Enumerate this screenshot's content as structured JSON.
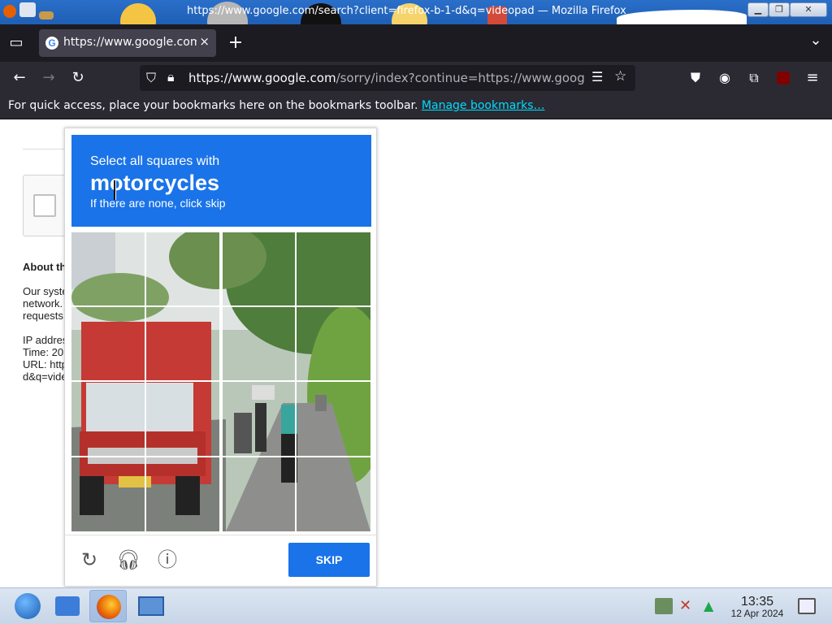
{
  "window": {
    "title": "https://www.google.com/search?client=firefox-b-1-d&q=videopad — Mozilla Firefox",
    "controls": [
      "minimize",
      "maximize",
      "close"
    ]
  },
  "tabs": [
    {
      "label": "https://www.google.com/",
      "icon": "google-g-icon",
      "close": "×"
    }
  ],
  "tabstrip": {
    "new_tab": "+",
    "list_all": "⌄"
  },
  "navbar": {
    "url_domain": "https://www.google.com",
    "url_rest": "/sorry/index?continue=https://www.google.com/"
  },
  "bookmarks_bar": {
    "text": "For quick access, place your bookmarks here on the bookmarks toolbar.",
    "link": "Manage bookmarks…"
  },
  "page": {
    "about_heading": "About th",
    "body_lines": [
      "Our syste",
      "network.",
      "requests"
    ],
    "ip_line": "IP addres",
    "time_line": "Time: 20",
    "url_line": "URL: http",
    "url_line2": "d&q=vide"
  },
  "captcha": {
    "instruction": "Select all squares with",
    "target": "motorcycles",
    "hint": "If there are none, click skip",
    "grid_size": 4,
    "skip_label": "SKIP",
    "footer_icons": [
      "reload-icon",
      "audio-icon",
      "info-icon"
    ],
    "colors": {
      "header": "#1a73e8",
      "button": "#1a73e8"
    }
  },
  "taskbar": {
    "time": "13:35",
    "date": "12 Apr 2024",
    "apps": [
      "start-button",
      "file-manager",
      "firefox",
      "control-panel"
    ]
  }
}
